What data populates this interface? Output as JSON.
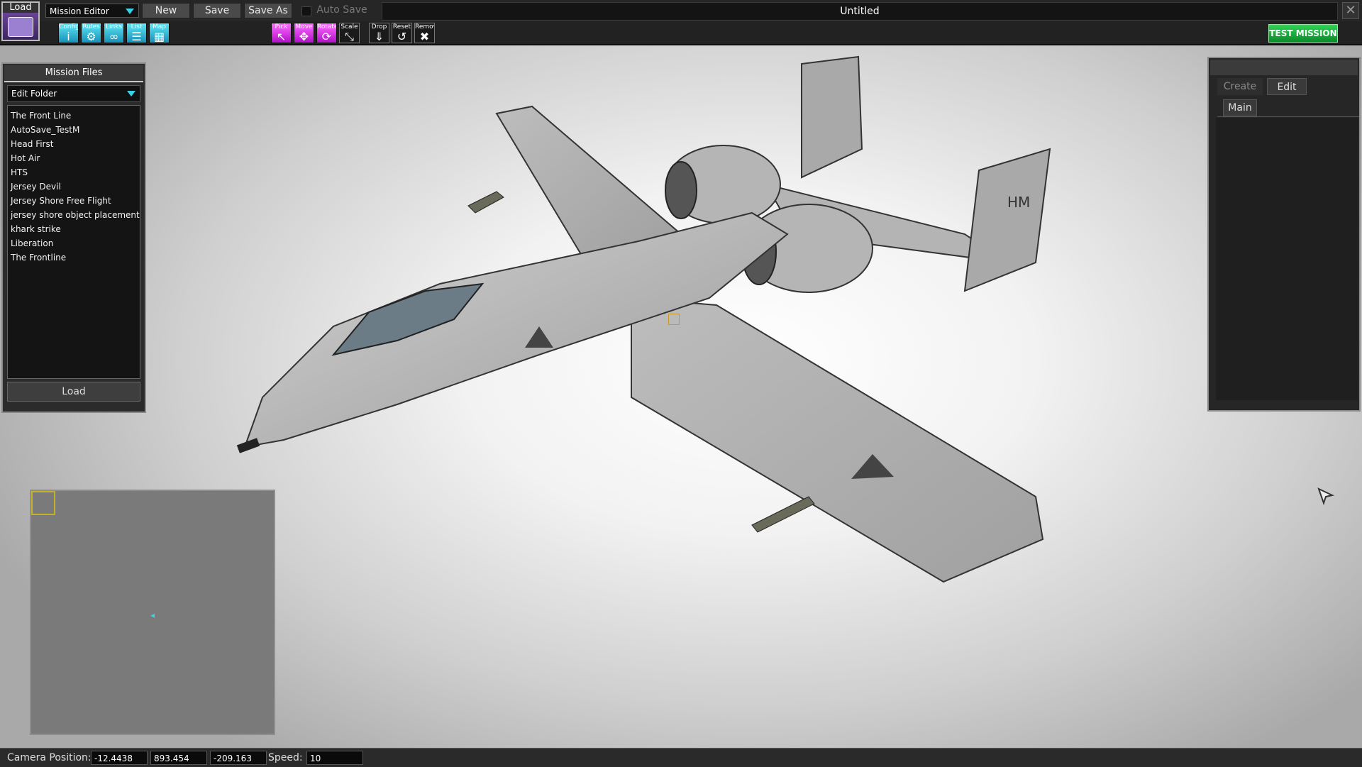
{
  "toolbar": {
    "load_label": "Load",
    "editor_select": "Mission Editor",
    "new_label": "New",
    "save_label": "Save",
    "save_as_label": "Save As",
    "auto_save_label": "Auto Save",
    "title": "Untitled",
    "tools_left": [
      {
        "label": "Config",
        "icon": "info-icon"
      },
      {
        "label": "Rules",
        "icon": "rules-icon"
      },
      {
        "label": "Links",
        "icon": "links-icon"
      },
      {
        "label": "List",
        "icon": "list-icon"
      },
      {
        "label": "Map",
        "icon": "map-icon"
      }
    ],
    "tools_mid": [
      {
        "label": "Pick",
        "icon": "pick-icon"
      },
      {
        "label": "Move",
        "icon": "move-icon"
      },
      {
        "label": "Rotate",
        "icon": "rotate-icon"
      },
      {
        "label": "Scale",
        "icon": "scale-icon"
      }
    ],
    "tools_right": [
      {
        "label": "Drop",
        "icon": "drop-icon"
      },
      {
        "label": "Reset",
        "icon": "reset-icon"
      },
      {
        "label": "Remove",
        "icon": "remove-icon"
      }
    ],
    "test_mission_label": "TEST MISSION"
  },
  "mission_files": {
    "title": "Mission Files",
    "folder_select": "Edit Folder",
    "files": [
      " The Front Line",
      "AutoSave_TestM",
      "Head First",
      "Hot Air",
      "HTS",
      "Jersey Devil",
      "Jersey Shore Free Flight",
      "jersey shore object placement",
      "khark strike",
      "Liberation",
      "The Frontline"
    ],
    "load_button": "Load"
  },
  "right_panel": {
    "tabs": [
      "Create",
      "Edit"
    ],
    "active_tab": "Edit",
    "subtab": "Main"
  },
  "status": {
    "camera_label": "Camera Position:",
    "camera_x": "-12.4438",
    "camera_y": "893.454",
    "camera_z": "-209.163",
    "speed_label": "Speed:",
    "speed": "10"
  },
  "colors": {
    "accent_cyan": "#3ad0e6",
    "tool_magenta": "#d21ee6",
    "test_green": "#1cb440"
  }
}
